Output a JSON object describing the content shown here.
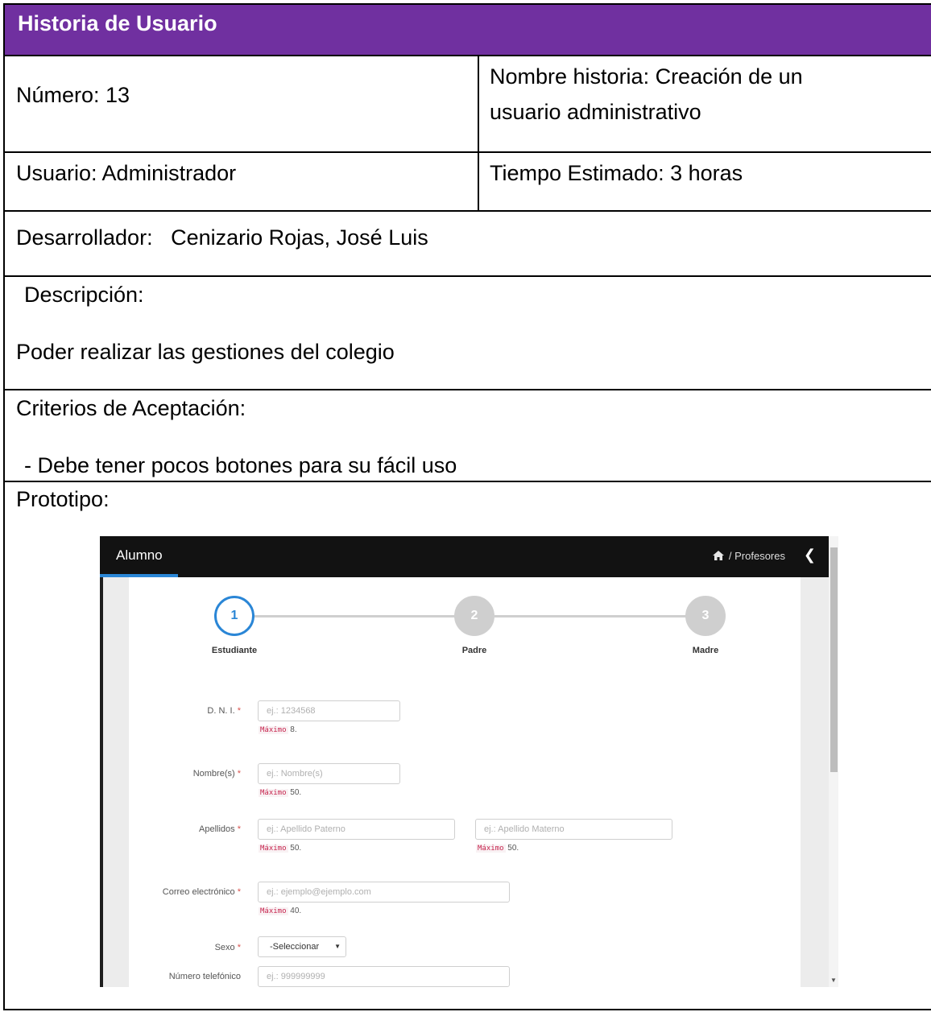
{
  "document": {
    "title": "Historia de Usuario",
    "numero": "Número: 13",
    "nombre_historia": [
      "Nombre historia: Creación de un",
      "usuario administrativo"
    ],
    "usuario": "Usuario: Administrador",
    "tiempo": "Tiempo Estimado: 3 horas",
    "desarrollador": "Desarrollador:   Cenizario Rojas, José Luis",
    "descripcion_label": "Descripción:",
    "descripcion": "Poder realizar las gestiones del colegio",
    "criterios_label": "Criterios de Aceptación:",
    "criterio_1": "- Debe tener pocos botones para su fácil uso",
    "prototipo_label": "Prototipo:",
    "header_color": "#7030a0"
  },
  "prototype": {
    "app_title": "Alumno",
    "breadcrumb": "/ Profesores",
    "back_icon": "chevron-left-icon",
    "home_icon": "home-icon",
    "steps": [
      {
        "number": "1",
        "label": "Estudiante",
        "active": true
      },
      {
        "number": "2",
        "label": "Padre",
        "active": false
      },
      {
        "number": "3",
        "label": "Madre",
        "active": false
      }
    ],
    "fields": {
      "dni": {
        "label": "D. N. I.",
        "placeholder": "ej.: 1234568",
        "hint_code": "Máximo",
        "hint_value": "8."
      },
      "nombres": {
        "label": "Nombre(s)",
        "placeholder": "ej.: Nombre(s)",
        "hint_code": "Máximo",
        "hint_value": "50."
      },
      "apellidos": {
        "label": "Apellidos",
        "placeholder_paterno": "ej.: Apellido Paterno",
        "placeholder_materno": "ej.: Apellido Materno",
        "hint_code": "Máximo",
        "hint_value": "50."
      },
      "correo": {
        "label": "Correo electrónico",
        "placeholder": "ej.: ejemplo@ejemplo.com",
        "hint_code": "Máximo",
        "hint_value": "40."
      },
      "sexo": {
        "label": "Sexo",
        "value": "-Seleccionar"
      },
      "telefono": {
        "label": "Número telefónico",
        "placeholder": "ej.: 999999999"
      }
    },
    "required_mark": "*",
    "accent_color": "#2a86d6"
  }
}
